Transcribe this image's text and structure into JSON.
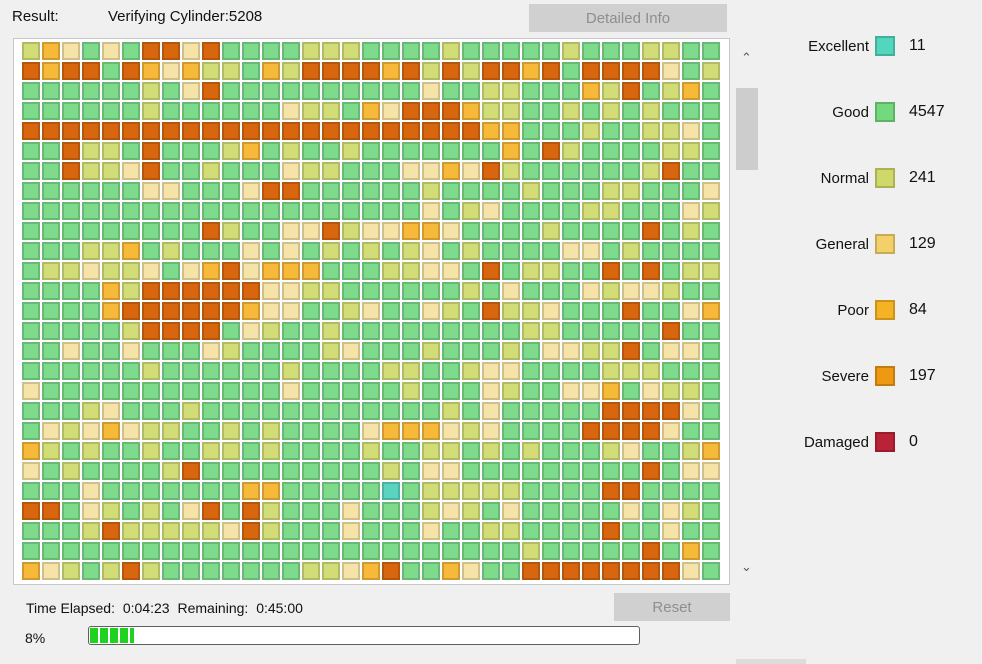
{
  "header": {
    "result_label": "Result:",
    "result_value": "Verifying Cylinder:5208",
    "detailed_info_label": "Detailed Info"
  },
  "legend": {
    "rows": [
      {
        "label": "Excellent",
        "count": "11",
        "color": "#52d6bd"
      },
      {
        "label": "Good",
        "count": "4547",
        "color": "#72d97c"
      },
      {
        "label": "Normal",
        "count": "241",
        "color": "#cfd96a"
      },
      {
        "label": "General",
        "count": "129",
        "color": "#f4d06a"
      },
      {
        "label": "Poor",
        "count": "84",
        "color": "#f5b324"
      },
      {
        "label": "Severe",
        "count": "197",
        "color": "#ee9911"
      },
      {
        "label": "Damaged",
        "count": "0",
        "color": "#bb2236"
      }
    ]
  },
  "grid": {
    "columns": 35,
    "rows": 27,
    "palette": {
      "e": "#5ad4c0",
      "g": "#7ddb8b",
      "n": "#d3dd77",
      "l": "#f5e3a8",
      "p": "#f7b93a",
      "s": "#d8660f",
      "d": "#bb2236"
    },
    "cells": [
      "nplgl ssl gg gnnngg gngg ggngggnnggg",
      "sp sgsplpnngpnssss snsnsspsgss sl n",
      "ggggg ngl gggggggggg ggnng gpnsgnpg",
      "ggggggngggggg nngplssspnnggngngnggg",
      "sssssssssssssssssssssssppgggnggnnlg",
      "gg nngsgggn gn gngggggggpgsnggggnng",
      "gg nnlsggn gglnng gllplsnggggggnsgg",
      "ggggg llgg lss gggggnggggngggnngggl",
      "gggggggggggggggggggg gnlggggnngggln",
      "ggggggggg nggllsnllpplggggnggggsgng",
      "gggnnpgnggglglgngngnlgngggg lgngggg",
      "gnnlnn glpslpppgggnn lg gnnggsgsgnn",
      "gggg nsssssslln gggggg glggglnllngg",
      "gggg ssssss ll gnlgg ngsnnlgggsgglp",
      "gggggnssss lnggngggggggggnngggggsgg",
      "gglgglggglngggg l ggngggngllnnsgllg",
      "ggggggnggggggnggggnnggnllggggnnnggg",
      "lgggggggggggglgggggnggglnggllpglnng",
      "gggnlgggnggggggggggggnglgggggsssslg",
      "glnlplnnggngngggglppplnlggggsssslgg",
      "pngnggnggnngnggggnggnngngnggg lggnp",
      "lgnggggnsgggggggggngllgggggggggsgll",
      "ggglggggggg pgggggegnnnnnggg ssgggg",
      "ssglngnglsgsnggglgggnlnglggggglglng",
      "gggnsnnnnnlsnggglggglggnnggggsgglgg",
      "gggggggggggggggggggggggggngggggsgpg",
      "plngnsngggggggnnlpsggplggsssssssslg"
    ]
  },
  "status": {
    "time_elapsed_label": "Time Elapsed:",
    "time_elapsed_value": "0:04:23",
    "remaining_label": "Remaining:",
    "remaining_value": "0:45:00",
    "reset_label": "Reset",
    "progress_percent": "8%",
    "progress_value": 8
  },
  "scrollbar": {
    "up_arrow": "⌃",
    "down_arrow": "⌄"
  }
}
